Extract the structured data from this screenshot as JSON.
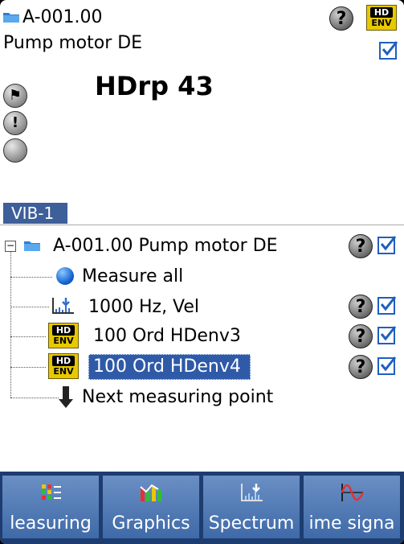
{
  "header": {
    "point_code": "A-001.00",
    "point_name": "Pump motor DE",
    "measurement_title": "HDrp 43",
    "badge_top": "HD",
    "badge_bottom": "ENV"
  },
  "section_label": "VIB-1",
  "tree": {
    "root_label": "A-001.00 Pump motor DE",
    "items": [
      {
        "label": "Measure all"
      },
      {
        "label": "1000 Hz, Vel"
      },
      {
        "label": "100 Ord HDenv3"
      },
      {
        "label": "100 Ord HDenv4"
      },
      {
        "label": "Next measuring point"
      }
    ]
  },
  "tabs": [
    {
      "label": "leasuring"
    },
    {
      "label": "Graphics"
    },
    {
      "label": "Spectrum"
    },
    {
      "label": "ime signa"
    }
  ],
  "colors": {
    "selection": "#2e5aa8",
    "tab": "#4a74b3",
    "section_label_bg": "#3d5f9a",
    "check": "#1f5fbf",
    "badge": "#e8c800"
  }
}
